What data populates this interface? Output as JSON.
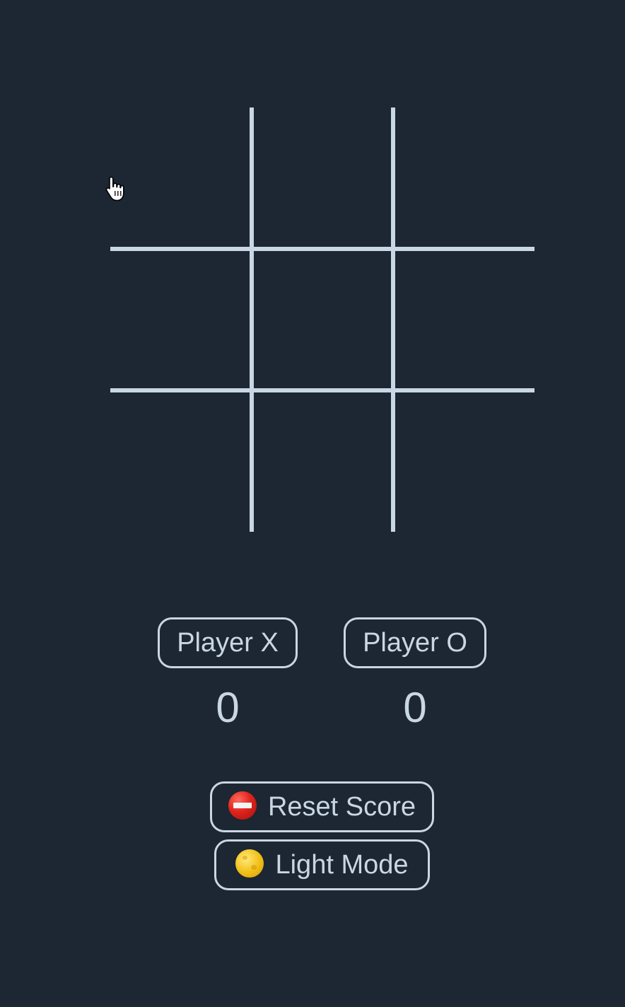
{
  "board": {
    "cells": [
      "",
      "",
      "",
      "",
      "",
      "",
      "",
      "",
      ""
    ]
  },
  "players": {
    "x": {
      "label": "Player X",
      "score": "0"
    },
    "o": {
      "label": "Player O",
      "score": "0"
    }
  },
  "actions": {
    "reset_label": "Reset Score",
    "reset_icon": "no-entry-icon",
    "mode_label": "Light Mode",
    "mode_icon": "moon-icon"
  },
  "colors": {
    "background": "#1d2633",
    "foreground": "#c9d6e3"
  }
}
